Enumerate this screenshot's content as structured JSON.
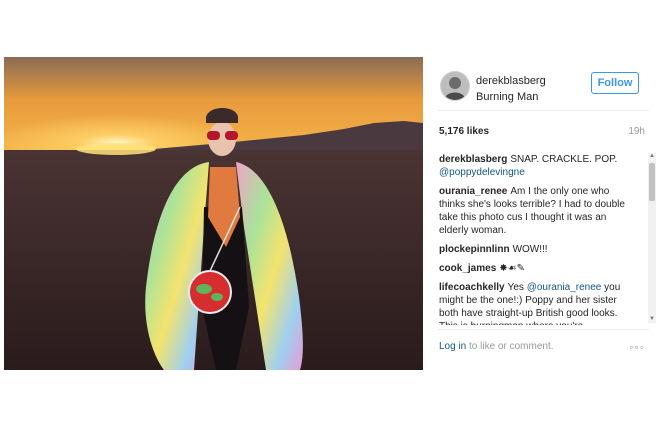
{
  "post": {
    "photo_alt": "",
    "header": {
      "username": "derekblasberg",
      "location": "Burning Man",
      "follow_label": "Follow"
    },
    "likes": "5,176 likes",
    "time": "19h",
    "comments": [
      {
        "user": "derekblasberg",
        "text": "SNAP. CRACKLE. POP.",
        "mention": "@poppydelevingne",
        "rest": ""
      },
      {
        "user": "ourania_renee",
        "text": "Am I the only one who thinks she's looks terrible? I had to double take this photo cus I thought it was an elderly woman.",
        "mention": "",
        "rest": ""
      },
      {
        "user": "plockepinnlinn",
        "text": "WOW!!!",
        "mention": "",
        "rest": ""
      },
      {
        "user": "cook_james",
        "text": "✸☙✎",
        "mention": "",
        "rest": ""
      },
      {
        "user": "lifecoachkelly",
        "text": "Yes",
        "mention": "@ourania_renee",
        "rest": "you might be the one!:) Poppy and her sister both have straight-up British good looks. This is burningman where you're"
      }
    ],
    "footer": {
      "login_link": "Log in",
      "login_text": "to like or comment.",
      "more_label": "◦◦◦"
    }
  },
  "colors": {
    "accent": "#3897f0",
    "link": "#125688"
  }
}
